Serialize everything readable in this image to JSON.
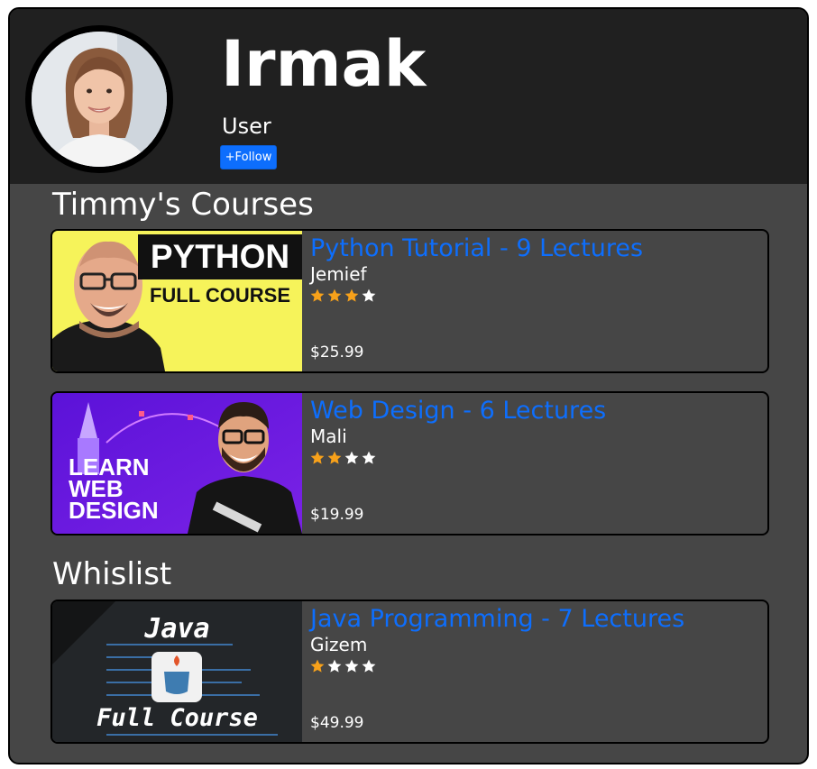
{
  "profile": {
    "name": "Irmak",
    "role": "User",
    "follow_label": "+Follow"
  },
  "sections": {
    "courses_title": "Timmy's Courses",
    "wishlist_title": "Whislist"
  },
  "courses": [
    {
      "title": "Python Tutorial - 9 Lectures",
      "instructor": "Jemief",
      "rating": 3,
      "max_rating": 4,
      "price": "$25.99",
      "thumb": {
        "line1": "PYTHON",
        "line2": "FULL COURSE"
      }
    },
    {
      "title": "Web Design - 6 Lectures",
      "instructor": "Mali",
      "rating": 2,
      "max_rating": 4,
      "price": "$19.99",
      "thumb": {
        "line1": "LEARN",
        "line2": "WEB",
        "line3": "DESIGN"
      }
    }
  ],
  "wishlist": [
    {
      "title": "Java Programming - 7 Lectures",
      "instructor": "Gizem",
      "rating": 1,
      "max_rating": 4,
      "price": "$49.99",
      "thumb": {
        "line1": "Java",
        "line2": "Full Course"
      }
    }
  ],
  "colors": {
    "accent": "#0d6efd",
    "star_filled": "#f7a11a",
    "star_empty": "#ffffff"
  }
}
